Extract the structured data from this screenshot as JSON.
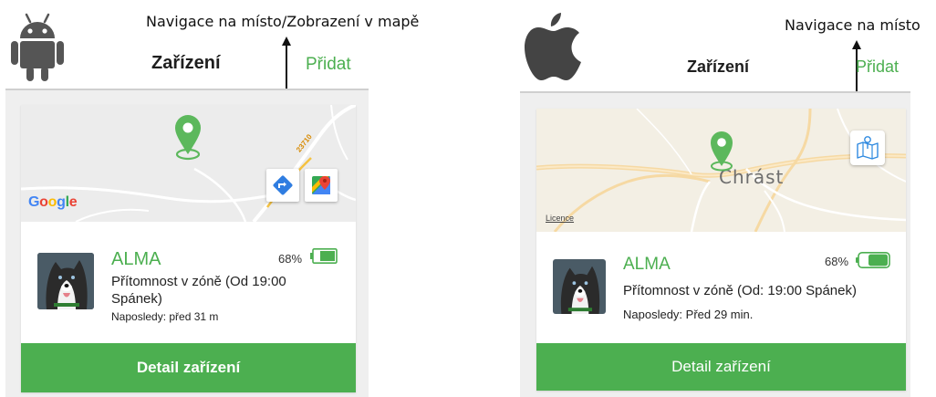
{
  "android": {
    "os_icon": "android-icon",
    "caption": "Navigace na místo/Zobrazení v mapě",
    "appbar": {
      "title": "Zařízení",
      "action": "Přidat"
    },
    "map": {
      "brand": [
        "G",
        "o",
        "o",
        "g",
        "l",
        "e"
      ],
      "road_label": "23710",
      "buttons": [
        {
          "icon": "directions-icon"
        },
        {
          "icon": "google-maps-icon"
        }
      ]
    },
    "device": {
      "name": "ALMA",
      "status": "Přítomnost v zóně (Od 19:00 Spánek)",
      "last_seen": "Naposledy: před 31 m",
      "battery": "68%",
      "battery_level": 0.68,
      "avatar_icon": "husky-avatar"
    },
    "detail_button": "Detail zařízení"
  },
  "ios": {
    "os_icon": "apple-icon",
    "caption": "Navigace na místo",
    "appbar": {
      "title": "Zařízení",
      "action": "Přidat"
    },
    "map": {
      "place": "Chrást",
      "licence": "Licence",
      "buttons": [
        {
          "icon": "map-navigation-icon"
        }
      ]
    },
    "device": {
      "name": "ALMA",
      "status": "Přítomnost v zóně  (Od: 19:00 Spánek)",
      "last_seen": "Naposledy: Před 29 min.",
      "battery": "68%",
      "battery_level": 0.68,
      "avatar_icon": "husky-avatar"
    },
    "detail_button": "Detail zařízení"
  },
  "colors": {
    "accent": "#4caf50",
    "pin": "#5cb85c",
    "android_green": "#a4c639"
  }
}
